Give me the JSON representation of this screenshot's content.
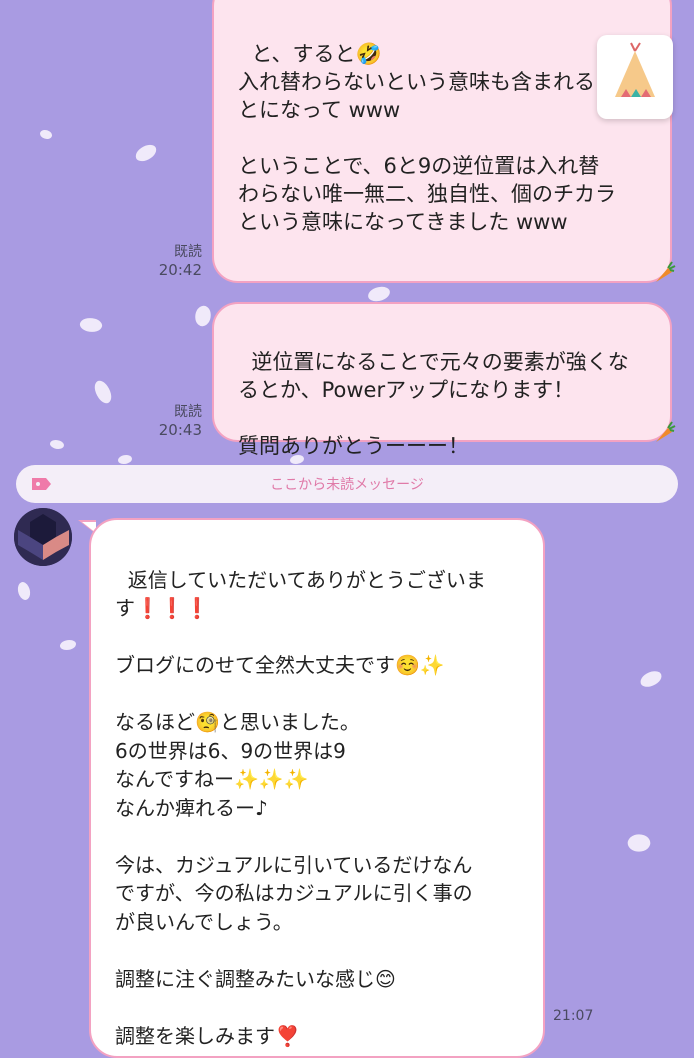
{
  "messages_out": [
    {
      "text": "と、すると🤣\n入れ替わらないという意味も含まれるこ\nとになって www\n\nということで、6と9の逆位置は入れ替\nわらない唯一無二、独自性、個のチカラ\nという意味になってきました www",
      "read_label": "既読",
      "time": "20:42"
    },
    {
      "text": "逆位置になることで元々の要素が強くな\nるとか、Powerアップになります！\n\n質問ありがとうーーー！",
      "read_label": "既読",
      "time": "20:43"
    }
  ],
  "divider": {
    "label": "ここから未読メッセージ"
  },
  "message_in": {
    "text": "返信していただいてありがとうございま\nす❗️❗️❗️\n\nブログにのせて全然大丈夫です☺️✨\n\nなるほど🧐と思いました。\n6の世界は6、9の世界は9\nなんですねー✨✨✨\nなんか痺れるー♪\n\n今は、カジュアルに引いているだけなん\nですが、今の私はカジュアルに引く事の\nが良いんでしょう。\n\n調整に注ぐ調整みたいな感じ😊\n\n調整を楽しみます❣️",
    "time": "21:07"
  },
  "colors": {
    "background": "#a99be2",
    "bubble_out": "#fde4ee",
    "bubble_border": "#f3a2c2",
    "bubble_in": "#ffffff",
    "divider_text": "#e07aa8"
  },
  "icons": [
    "carrot-icon",
    "tag-icon",
    "avatar",
    "tent-icon"
  ]
}
